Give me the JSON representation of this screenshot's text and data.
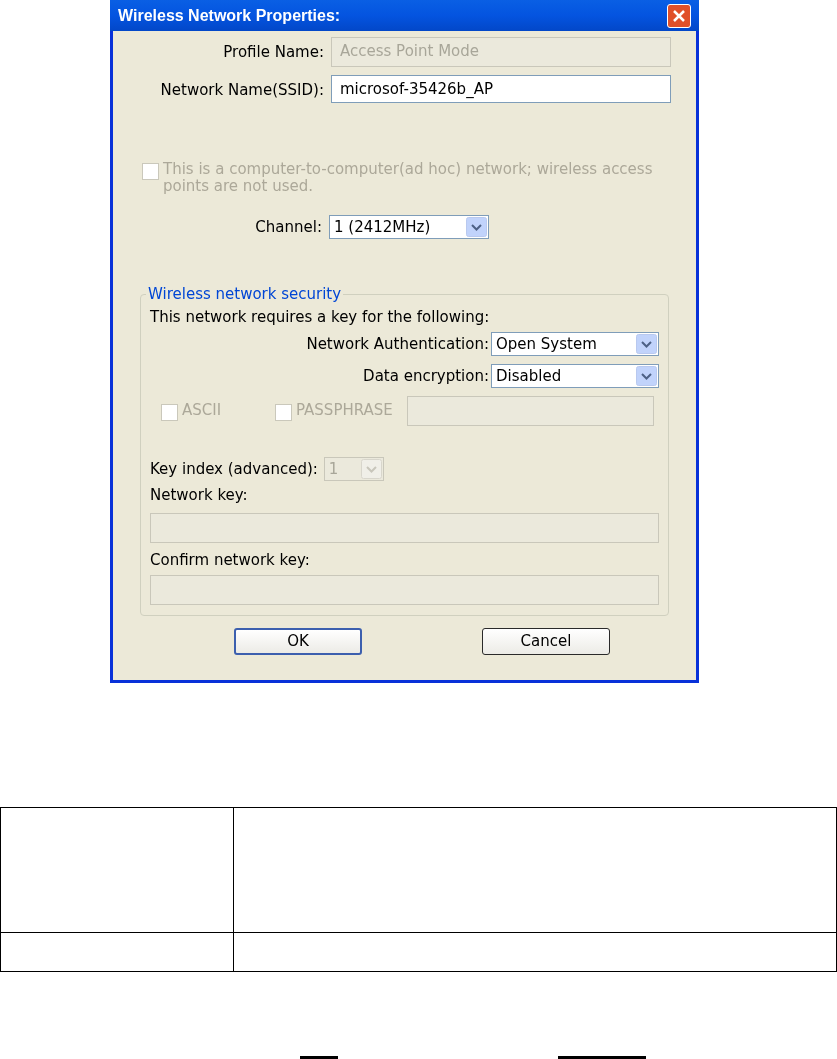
{
  "window": {
    "title": "Wireless Network Properties:"
  },
  "profile_name": {
    "label": "Profile Name:",
    "value": "Access Point Mode",
    "disabled": true
  },
  "ssid": {
    "label": "Network Name(SSID):",
    "value": "microsof-35426b_AP",
    "disabled": false
  },
  "adhoc": {
    "label": "This is a computer-to-computer(ad hoc) network; wireless access points are not used.",
    "checked": false,
    "disabled": true
  },
  "channel": {
    "label": "Channel:",
    "value": "1  (2412MHz)",
    "disabled": false
  },
  "security": {
    "legend": "Wireless network security",
    "note": "This network requires a key for the following:",
    "authentication": {
      "label": "Network Authentication:",
      "value": "Open System",
      "disabled": false
    },
    "encryption": {
      "label": "Data encryption:",
      "value": "Disabled",
      "disabled": false
    },
    "checkboxes": [
      {
        "label": "ASCII",
        "checked": false,
        "disabled": true
      },
      {
        "label": "PASSPHRASE",
        "checked": false,
        "disabled": true
      }
    ],
    "passphrase_field": {
      "disabled": true
    },
    "key_index": {
      "label": "Key index (advanced):",
      "value": "1",
      "disabled": true
    },
    "network_key": {
      "label": "Network key:",
      "disabled": true
    },
    "confirm_key": {
      "label": "Confirm network key:",
      "disabled": true
    }
  },
  "buttons": [
    {
      "label": "OK",
      "default": true
    },
    {
      "label": "Cancel",
      "default": false
    }
  ]
}
